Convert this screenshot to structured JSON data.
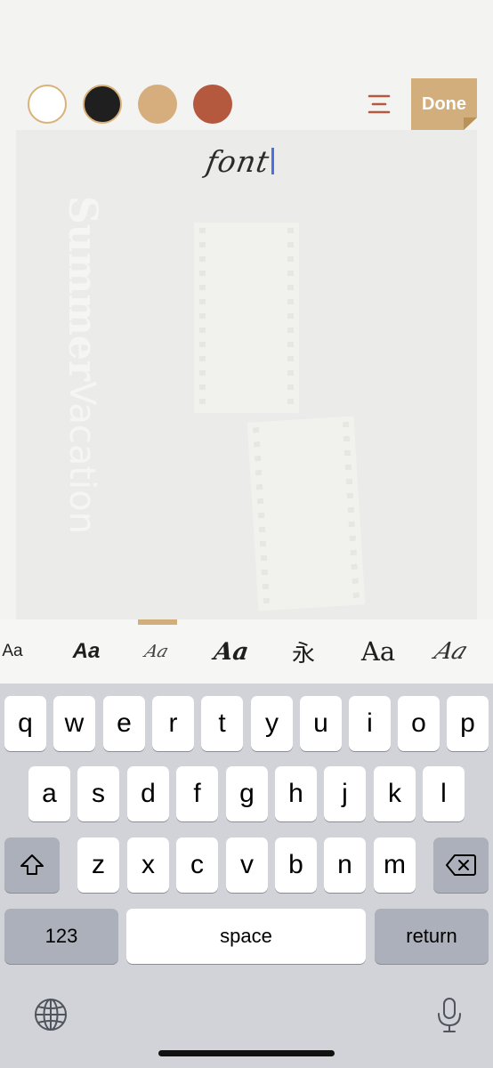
{
  "colors": {
    "swatches": [
      "#ffffff",
      "#1f1f1f",
      "#d6ae7d",
      "#b4593e"
    ],
    "accent": "#d2ae7c",
    "menu_icon_color": "#b4593e",
    "caret": "#4d6fe0"
  },
  "toolbar": {
    "menu_icon": "menu-lines-icon",
    "done_label": "Done"
  },
  "canvas": {
    "background_title_bold": "Summer",
    "background_title_light": "Vacation",
    "editing_text": "font"
  },
  "font_styles": [
    "Aa",
    "Aa",
    "Aa",
    "Aa",
    "永",
    "Aa",
    "Aa"
  ],
  "keyboard": {
    "row1": [
      "q",
      "w",
      "e",
      "r",
      "t",
      "y",
      "u",
      "i",
      "o",
      "p"
    ],
    "row2": [
      "a",
      "s",
      "d",
      "f",
      "g",
      "h",
      "j",
      "k",
      "l"
    ],
    "row3": [
      "z",
      "x",
      "c",
      "v",
      "b",
      "n",
      "m"
    ],
    "shift_icon": "shift-icon",
    "backspace_icon": "backspace-icon",
    "numbers_label": "123",
    "space_label": "space",
    "return_label": "return",
    "globe_icon": "globe-icon",
    "mic_icon": "microphone-icon"
  }
}
